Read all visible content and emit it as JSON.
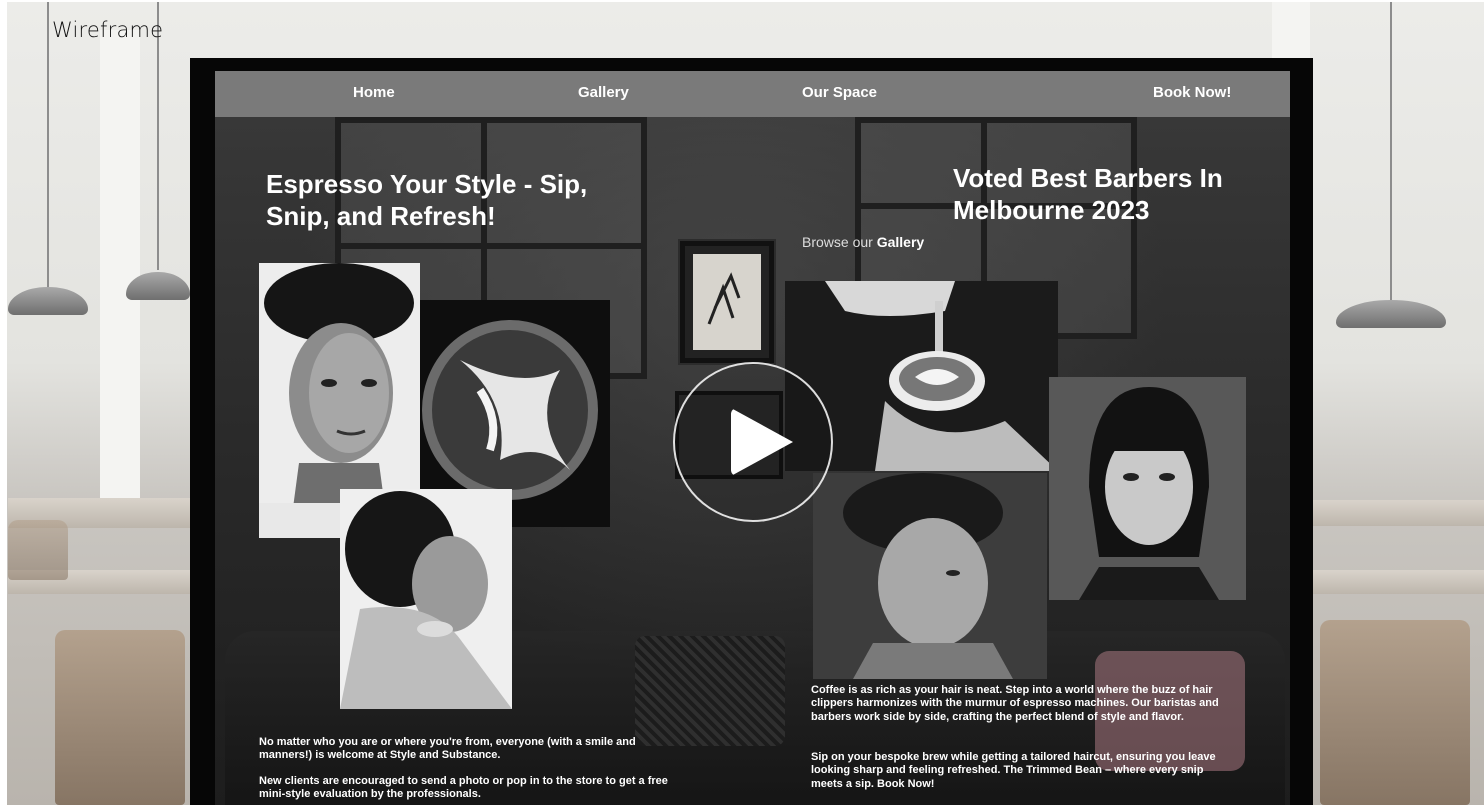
{
  "page": {
    "title": "Wireframe"
  },
  "nav": {
    "items": [
      "Home",
      "Gallery",
      "Our Space",
      "Book Now!"
    ]
  },
  "hero": {
    "headline_left": "Espresso Your Style - Sip, Snip, and Refresh!",
    "headline_right": "Voted Best Barbers In Melbourne 2023",
    "browse_prefix": "Browse our",
    "browse_link": "Gallery",
    "left_para_1": "No matter who you are or where you're from, everyone (with a smile and manners!) is welcome at Style and Substance.",
    "left_para_2": "New clients are encouraged to send a photo or pop in to the store to get a free mini-style evaluation by the professionals.",
    "right_para_1": "Coffee is as rich as your hair is neat. Step into a world where the buzz of hair clippers harmonizes with the murmur of espresso machines. Our baristas and barbers work side by side, crafting the perfect blend of style and flavor.",
    "right_para_2": "Sip on your bespoke brew while getting a tailored haircut, ensuring you leave looking sharp and feeling refreshed. The Trimmed Bean – where every snip meets a sip. Book Now!"
  },
  "icons": {
    "play": "play-icon"
  },
  "colors": {
    "navbar": "#7a7a7a",
    "frame": "#060606",
    "text": "#ffffff"
  }
}
